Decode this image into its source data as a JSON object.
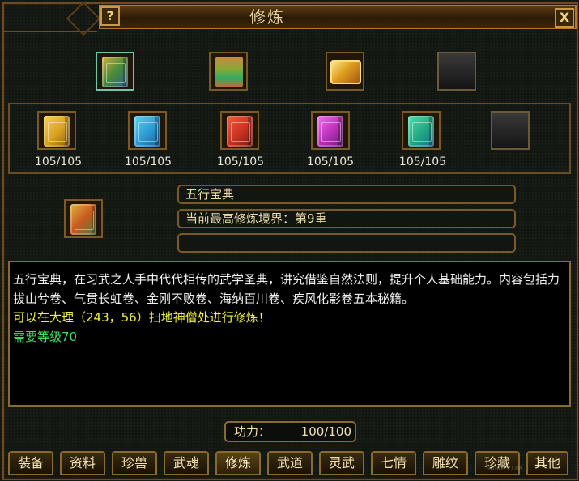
{
  "window": {
    "title": "修炼",
    "help_label": "?",
    "close_label": "X"
  },
  "top_slots": [
    {
      "name": "五行宝典",
      "icon": "book-icon",
      "color": "#4a8a3a",
      "selected": true
    },
    {
      "name": "",
      "icon": "scroll-bundle-icon",
      "color": "#8a3a1a",
      "selected": false
    },
    {
      "name": "",
      "icon": "gold-book-icon",
      "color": "#e0a020",
      "selected": false
    },
    {
      "name": "",
      "icon": "empty-slot-icon",
      "color": "#2a2a2a",
      "selected": false
    }
  ],
  "book_slots": [
    {
      "color": "#d8a020",
      "count": "105/105"
    },
    {
      "color": "#2a9ad0",
      "count": "105/105"
    },
    {
      "color": "#c83020",
      "count": "105/105"
    },
    {
      "color": "#b830b8",
      "count": "105/105"
    },
    {
      "color": "#20a880",
      "count": "105/105"
    },
    {
      "color": "#2a2a2a",
      "count": ""
    }
  ],
  "selected": {
    "name": "五行宝典",
    "realm": "当前最高修炼境界：第9重",
    "extra": ""
  },
  "description": {
    "text": "五行宝典，在习武之人手中代代相传的武学圣典，讲究借鉴自然法则，提升个人基础能力。内容包括力拔山兮卷、气贯长虹卷、金刚不败卷、海纳百川卷、疾风化影卷五本秘籍。",
    "location": "可以在大理（243，56）扫地神僧处进行修炼！",
    "requirement": "需要等级70"
  },
  "power": {
    "label": "功力：",
    "value": "100/100"
  },
  "tabs": [
    "装备",
    "资料",
    "珍兽",
    "武魂",
    "修炼",
    "武道",
    "灵武",
    "七情",
    "雕纹",
    "珍藏",
    "其他"
  ],
  "active_tab": "修炼",
  "watermark": {
    "text": "",
    "site": "SAIKR.COM"
  }
}
